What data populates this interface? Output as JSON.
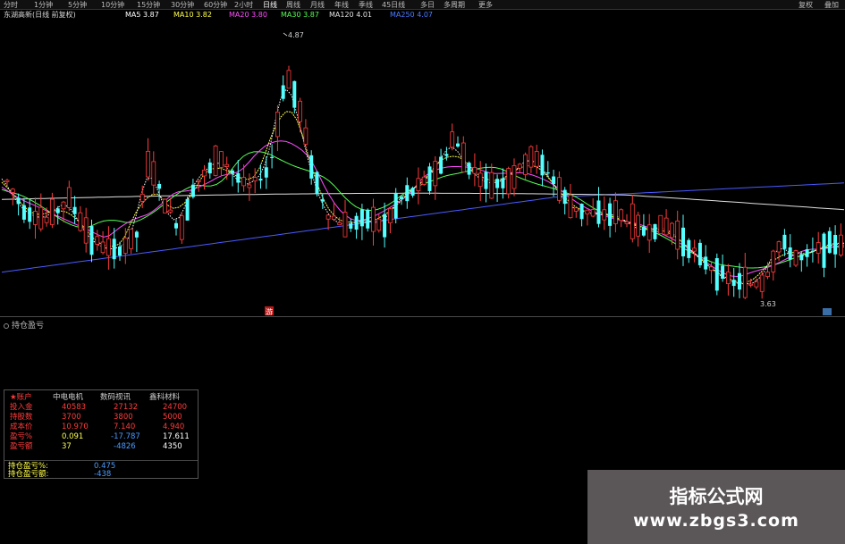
{
  "toolbar": {
    "items": [
      "分时",
      "1分钟",
      "5分钟",
      "10分钟",
      "15分钟",
      "30分钟",
      "60分钟",
      "2小时",
      "日线",
      "周线",
      "月线",
      "年线",
      "季线",
      "45日线",
      "多日",
      "多周期",
      "更多"
    ],
    "selected": "日线",
    "right": [
      "复权",
      "叠加"
    ]
  },
  "ma_bar": {
    "label": "东湖高新(日线 前复权)",
    "ma5": "MA5 3.87",
    "ma10": "MA10 3.82",
    "ma20": "MA20 3.80",
    "ma30": "MA30 3.87",
    "ma120": "MA120 4.01",
    "ma250": "MA250 4.07"
  },
  "chart_annotations": {
    "high_label": "4.87",
    "low_label": "3.63",
    "badge": "游"
  },
  "colors": {
    "up": "#ff3b3b",
    "down": "#54ffff",
    "ma5": "#ffffff",
    "ma10": "#ffff4c",
    "ma20": "#ff4cff",
    "ma30": "#55ff55",
    "ma120": "#4a5bff",
    "ma250": "#e0e0e0"
  },
  "sub_panel": {
    "title": "持仓盈亏"
  },
  "account_table": {
    "headers": [
      "★账户",
      "中电电机",
      "数码视讯",
      "鑫科材料"
    ],
    "rows": [
      {
        "label": "投入金",
        "values": [
          "40583",
          "27132",
          "24700"
        ]
      },
      {
        "label": "持股数",
        "values": [
          "3700",
          "3800",
          "5000"
        ]
      },
      {
        "label": "成本价",
        "values": [
          "10.970",
          "7.140",
          "4.940"
        ]
      },
      {
        "label": "盈亏%",
        "values": [
          "0.091",
          "-17.787",
          "17.611"
        ]
      },
      {
        "label": "盈亏额",
        "values": [
          "37",
          "-4826",
          "4350"
        ]
      }
    ],
    "footer": [
      {
        "label": "持仓盈亏%:",
        "value": "0.475"
      },
      {
        "label": "持仓盈亏额:",
        "value": "-438"
      }
    ]
  },
  "watermark": {
    "title": "指标公式网",
    "url": "www.zbgs3.com"
  }
}
